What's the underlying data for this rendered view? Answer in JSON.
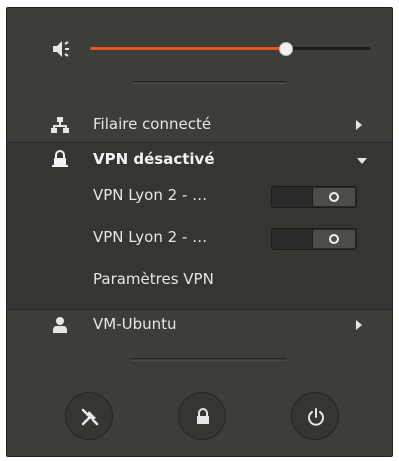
{
  "volume": {
    "level_percent": 70
  },
  "network": {
    "wired_label": "Filaire connecté"
  },
  "vpn": {
    "header_label": "VPN désactivé",
    "connections": [
      {
        "label": "VPN Lyon 2 - …",
        "enabled": false
      },
      {
        "label": "VPN Lyon 2 - …",
        "enabled": false
      }
    ],
    "settings_label": "Paramètres VPN"
  },
  "user": {
    "label": "VM-Ubuntu"
  },
  "colors": {
    "accent": "#e95420",
    "menu_bg": "#3d3d3a",
    "text": "#e6e6e6"
  },
  "icons": {
    "volume": "audio-volume-icon",
    "wired": "network-wired-icon",
    "vpn": "lock-icon",
    "user": "user-icon",
    "settings": "tools-icon",
    "lock": "lock-icon",
    "power": "power-icon"
  }
}
